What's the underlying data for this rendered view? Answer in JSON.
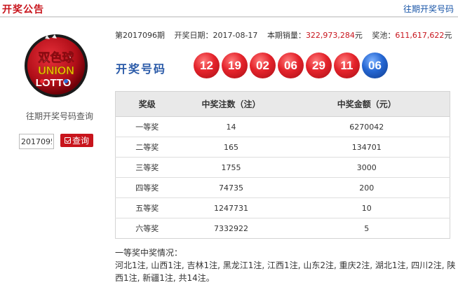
{
  "header": {
    "title": "开奖公告",
    "history_link": "往期开奖号码"
  },
  "logo": {
    "brand": "双色球",
    "sub1": "UNION",
    "sub2": "LOTTO"
  },
  "left": {
    "caption": "往期开奖号码查询",
    "period_input_value": "2017095",
    "query_label": "查询"
  },
  "info": {
    "period_label": "第2017096期",
    "date_label": "开奖日期：",
    "date_value": "2017-08-17",
    "sales_label": "本期销量：",
    "sales_value": "322,973,284",
    "sales_unit": "元",
    "pool_label": "奖池：",
    "pool_value": "611,617,622",
    "pool_unit": "元"
  },
  "draw": {
    "label": "开奖号码",
    "red_balls": [
      "12",
      "19",
      "02",
      "06",
      "29",
      "11"
    ],
    "blue_ball": "06"
  },
  "table": {
    "headers": [
      "奖级",
      "中奖注数（注）",
      "中奖金额（元）"
    ],
    "rows": [
      {
        "level": "一等奖",
        "count": "14",
        "amount": "6270042"
      },
      {
        "level": "二等奖",
        "count": "165",
        "amount": "134701"
      },
      {
        "level": "三等奖",
        "count": "1755",
        "amount": "3000"
      },
      {
        "level": "四等奖",
        "count": "74735",
        "amount": "200"
      },
      {
        "level": "五等奖",
        "count": "1247731",
        "amount": "10"
      },
      {
        "level": "六等奖",
        "count": "7332922",
        "amount": "5"
      }
    ]
  },
  "winners": {
    "title": "一等奖中奖情况：",
    "detail": "河北1注, 山西1注, 吉林1注, 黑龙江1注, 江西1注, 山东2注, 重庆2注, 湖北1注, 四川2注, 陕西1注, 新疆1注, 共14注。"
  },
  "colors": {
    "accent_red": "#c8141c",
    "link_blue": "#1a56a8",
    "blue_ball": "#2466d2",
    "red_ball": "#e4232b"
  }
}
